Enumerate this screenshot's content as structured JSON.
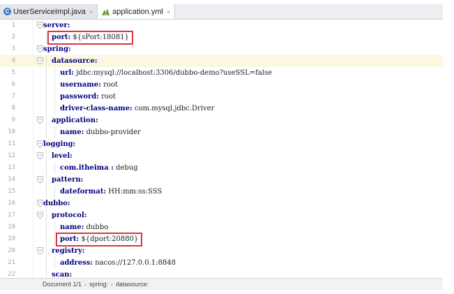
{
  "tabs": [
    {
      "label": "UserServiceImpl.java",
      "icon": "java-class-icon",
      "active": false,
      "icon_color": "#3d7cc9"
    },
    {
      "label": "application.yml",
      "icon": "yaml-file-icon",
      "active": true,
      "icon_color": "#6a9e3e"
    }
  ],
  "tab_close_glyph": "×",
  "editor": {
    "current_line": 4,
    "lines": [
      {
        "n": "1",
        "indent": 0,
        "key": "server:",
        "value": ""
      },
      {
        "n": "2",
        "indent": 1,
        "key": "port:",
        "value": " ${sPort:18081}"
      },
      {
        "n": "3",
        "indent": 0,
        "key": "spring:",
        "value": ""
      },
      {
        "n": "4",
        "indent": 1,
        "key": "datasource:",
        "value": ""
      },
      {
        "n": "5",
        "indent": 2,
        "key": "url:",
        "value": " jdbc:mysql://localhost:3306/dubbo-demo?useSSL=false"
      },
      {
        "n": "6",
        "indent": 2,
        "key": "username:",
        "value": " root"
      },
      {
        "n": "7",
        "indent": 2,
        "key": "password:",
        "value": " root"
      },
      {
        "n": "8",
        "indent": 2,
        "key": "driver-class-name:",
        "value": " com.mysql.jdbc.Driver"
      },
      {
        "n": "9",
        "indent": 1,
        "key": "application:",
        "value": ""
      },
      {
        "n": "10",
        "indent": 2,
        "key": "name:",
        "value": " dubbo-provider"
      },
      {
        "n": "11",
        "indent": 0,
        "key": "logging:",
        "value": ""
      },
      {
        "n": "12",
        "indent": 1,
        "key": "level:",
        "value": ""
      },
      {
        "n": "13",
        "indent": 2,
        "key": "com.itheima :",
        "value": " debug"
      },
      {
        "n": "14",
        "indent": 1,
        "key": "pattern:",
        "value": ""
      },
      {
        "n": "15",
        "indent": 2,
        "key": "dateformat:",
        "value": " HH:mm:ss:SSS"
      },
      {
        "n": "16",
        "indent": 0,
        "key": "dubbo:",
        "value": ""
      },
      {
        "n": "17",
        "indent": 1,
        "key": "protocol:",
        "value": ""
      },
      {
        "n": "18",
        "indent": 2,
        "key": "name:",
        "value": " dubbo"
      },
      {
        "n": "19",
        "indent": 2,
        "key": "port:",
        "value": " ${dport:20880}"
      },
      {
        "n": "20",
        "indent": 1,
        "key": "registry:",
        "value": ""
      },
      {
        "n": "21",
        "indent": 2,
        "key": "address:",
        "value": " nacos://127.0.0.1:8848"
      },
      {
        "n": "22",
        "indent": 1,
        "key": "scan:",
        "value": ""
      }
    ],
    "highlighted_lines": [
      "2",
      "19"
    ],
    "highlight_color": "#d9363e",
    "current_line_color": "#fcf8e0",
    "key_color": "#00007f"
  },
  "statusbar": {
    "document": "Document 1/1",
    "breadcrumbs": [
      "spring:",
      "datasource:"
    ],
    "separator": "›"
  }
}
